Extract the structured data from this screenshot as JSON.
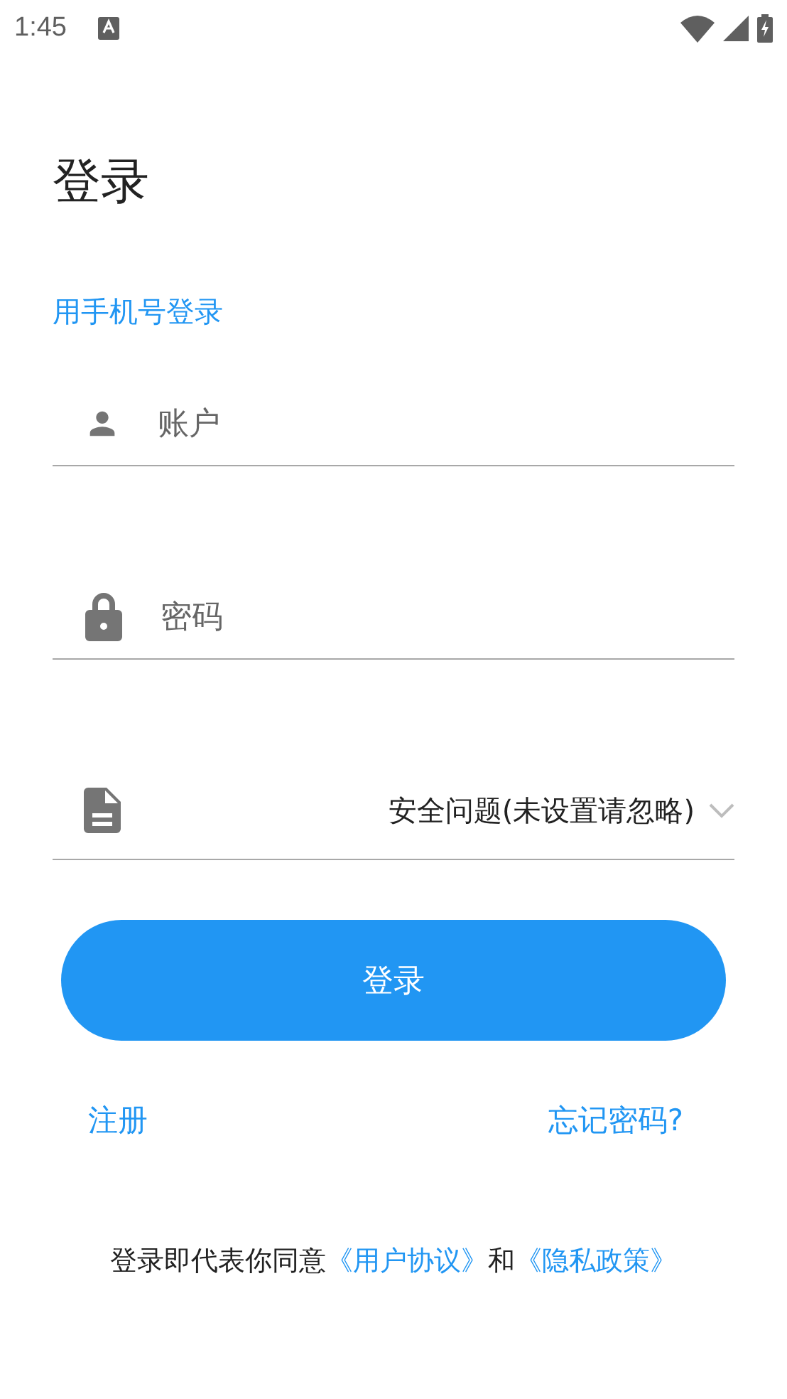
{
  "status_bar": {
    "time": "1:45"
  },
  "title": "登录",
  "phone_login_link": "用手机号登录",
  "fields": [
    {
      "kind": "account",
      "placeholder": "账户"
    },
    {
      "kind": "password",
      "placeholder": "密码"
    }
  ],
  "security_question": {
    "value": "安全问题(未设置请忽略)"
  },
  "login_button": "登录",
  "register_link": "注册",
  "forgot_password_link": "忘记密码?",
  "agreement": {
    "prefix": "登录即代表你同意",
    "user_agreement_link": "《用户协议》",
    "conjunction": "和",
    "privacy_policy_link": "《隐私政策》"
  }
}
